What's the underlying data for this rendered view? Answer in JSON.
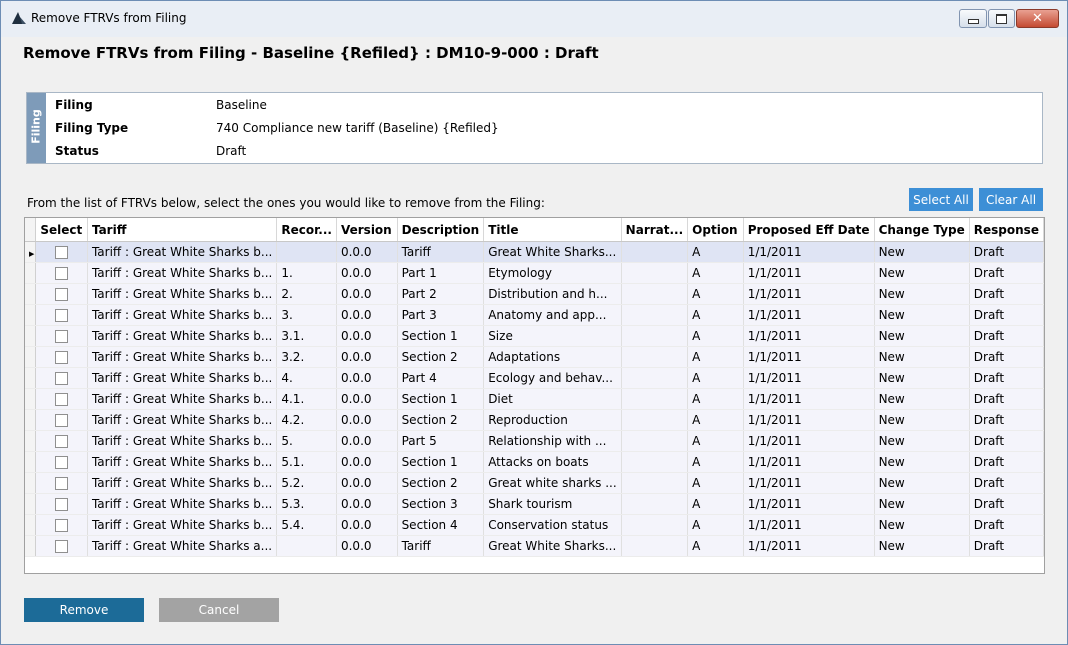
{
  "window": {
    "title": "Remove FTRVs from Filing",
    "buttons": {
      "minimize": "–",
      "maximize": "□",
      "close": "✕"
    }
  },
  "page_title": "Remove FTRVs from Filing - Baseline {Refiled} : DM10-9-000 : Draft",
  "filing": {
    "side_label": "Filing",
    "rows": [
      {
        "label": "Filing",
        "value": "Baseline"
      },
      {
        "label": "Filing Type",
        "value": "740 Compliance new tariff (Baseline) {Refiled}"
      },
      {
        "label": "Status",
        "value": "Draft"
      }
    ]
  },
  "instructions": "From the list of FTRVs below, select the ones you would like to remove from the Filing:",
  "actions": {
    "select_all": "Select All",
    "clear_all": "Clear All"
  },
  "grid": {
    "columns": [
      "Select",
      "Tariff",
      "Recor...",
      "Version",
      "Description",
      "Title",
      "Narrat...",
      "Option",
      "Proposed Eff Date",
      "Change Type",
      "Response"
    ],
    "rows": [
      {
        "tariff": "Tariff : Great White Sharks b...",
        "record": "",
        "version": "0.0.0",
        "description": "Tariff",
        "title": "Great White Sharks...",
        "narrative": "",
        "option": "A",
        "date": "1/1/2011",
        "change": "New",
        "response": "Draft"
      },
      {
        "tariff": "Tariff : Great White Sharks b...",
        "record": "1.",
        "version": "0.0.0",
        "description": "Part 1",
        "title": "Etymology",
        "narrative": "",
        "option": "A",
        "date": "1/1/2011",
        "change": "New",
        "response": "Draft"
      },
      {
        "tariff": "Tariff : Great White Sharks b...",
        "record": "2.",
        "version": "0.0.0",
        "description": "Part 2",
        "title": "Distribution and h...",
        "narrative": "",
        "option": "A",
        "date": "1/1/2011",
        "change": "New",
        "response": "Draft"
      },
      {
        "tariff": "Tariff : Great White Sharks b...",
        "record": "3.",
        "version": "0.0.0",
        "description": "Part 3",
        "title": "Anatomy and app...",
        "narrative": "",
        "option": "A",
        "date": "1/1/2011",
        "change": "New",
        "response": "Draft"
      },
      {
        "tariff": "Tariff : Great White Sharks b...",
        "record": "3.1.",
        "version": "0.0.0",
        "description": "Section 1",
        "title": "Size",
        "narrative": "",
        "option": "A",
        "date": "1/1/2011",
        "change": "New",
        "response": "Draft"
      },
      {
        "tariff": "Tariff : Great White Sharks b...",
        "record": "3.2.",
        "version": "0.0.0",
        "description": "Section 2",
        "title": "Adaptations",
        "narrative": "",
        "option": "A",
        "date": "1/1/2011",
        "change": "New",
        "response": "Draft"
      },
      {
        "tariff": "Tariff : Great White Sharks b...",
        "record": "4.",
        "version": "0.0.0",
        "description": "Part 4",
        "title": "Ecology and behav...",
        "narrative": "",
        "option": "A",
        "date": "1/1/2011",
        "change": "New",
        "response": "Draft"
      },
      {
        "tariff": "Tariff : Great White Sharks b...",
        "record": "4.1.",
        "version": "0.0.0",
        "description": "Section 1",
        "title": "Diet",
        "narrative": "",
        "option": "A",
        "date": "1/1/2011",
        "change": "New",
        "response": "Draft"
      },
      {
        "tariff": "Tariff : Great White Sharks b...",
        "record": "4.2.",
        "version": "0.0.0",
        "description": "Section 2",
        "title": "Reproduction",
        "narrative": "",
        "option": "A",
        "date": "1/1/2011",
        "change": "New",
        "response": "Draft"
      },
      {
        "tariff": "Tariff : Great White Sharks b...",
        "record": "5.",
        "version": "0.0.0",
        "description": "Part 5",
        "title": "Relationship with ...",
        "narrative": "",
        "option": "A",
        "date": "1/1/2011",
        "change": "New",
        "response": "Draft"
      },
      {
        "tariff": "Tariff : Great White Sharks b...",
        "record": "5.1.",
        "version": "0.0.0",
        "description": "Section 1",
        "title": "Attacks on boats",
        "narrative": "",
        "option": "A",
        "date": "1/1/2011",
        "change": "New",
        "response": "Draft"
      },
      {
        "tariff": "Tariff : Great White Sharks b...",
        "record": "5.2.",
        "version": "0.0.0",
        "description": "Section 2",
        "title": "Great white sharks ...",
        "narrative": "",
        "option": "A",
        "date": "1/1/2011",
        "change": "New",
        "response": "Draft"
      },
      {
        "tariff": "Tariff : Great White Sharks b...",
        "record": "5.3.",
        "version": "0.0.0",
        "description": "Section 3",
        "title": "Shark tourism",
        "narrative": "",
        "option": "A",
        "date": "1/1/2011",
        "change": "New",
        "response": "Draft"
      },
      {
        "tariff": "Tariff : Great White Sharks b...",
        "record": "5.4.",
        "version": "0.0.0",
        "description": "Section 4",
        "title": "Conservation status",
        "narrative": "",
        "option": "A",
        "date": "1/1/2011",
        "change": "New",
        "response": "Draft"
      },
      {
        "tariff": "Tariff : Great White Sharks a...",
        "record": "",
        "version": "0.0.0",
        "description": "Tariff",
        "title": "Great White Sharks...",
        "narrative": "",
        "option": "A",
        "date": "1/1/2011",
        "change": "New",
        "response": "Draft"
      }
    ]
  },
  "footer": {
    "remove": "Remove",
    "cancel": "Cancel"
  },
  "colors": {
    "accent_blue": "#3d8fd6",
    "remove_button": "#1c6b98",
    "cancel_button": "#a3a3a3",
    "filing_side": "#7e9bb9"
  },
  "icons": {
    "app": "shark-fin-icon",
    "current_row": "current-row-arrow-icon"
  }
}
